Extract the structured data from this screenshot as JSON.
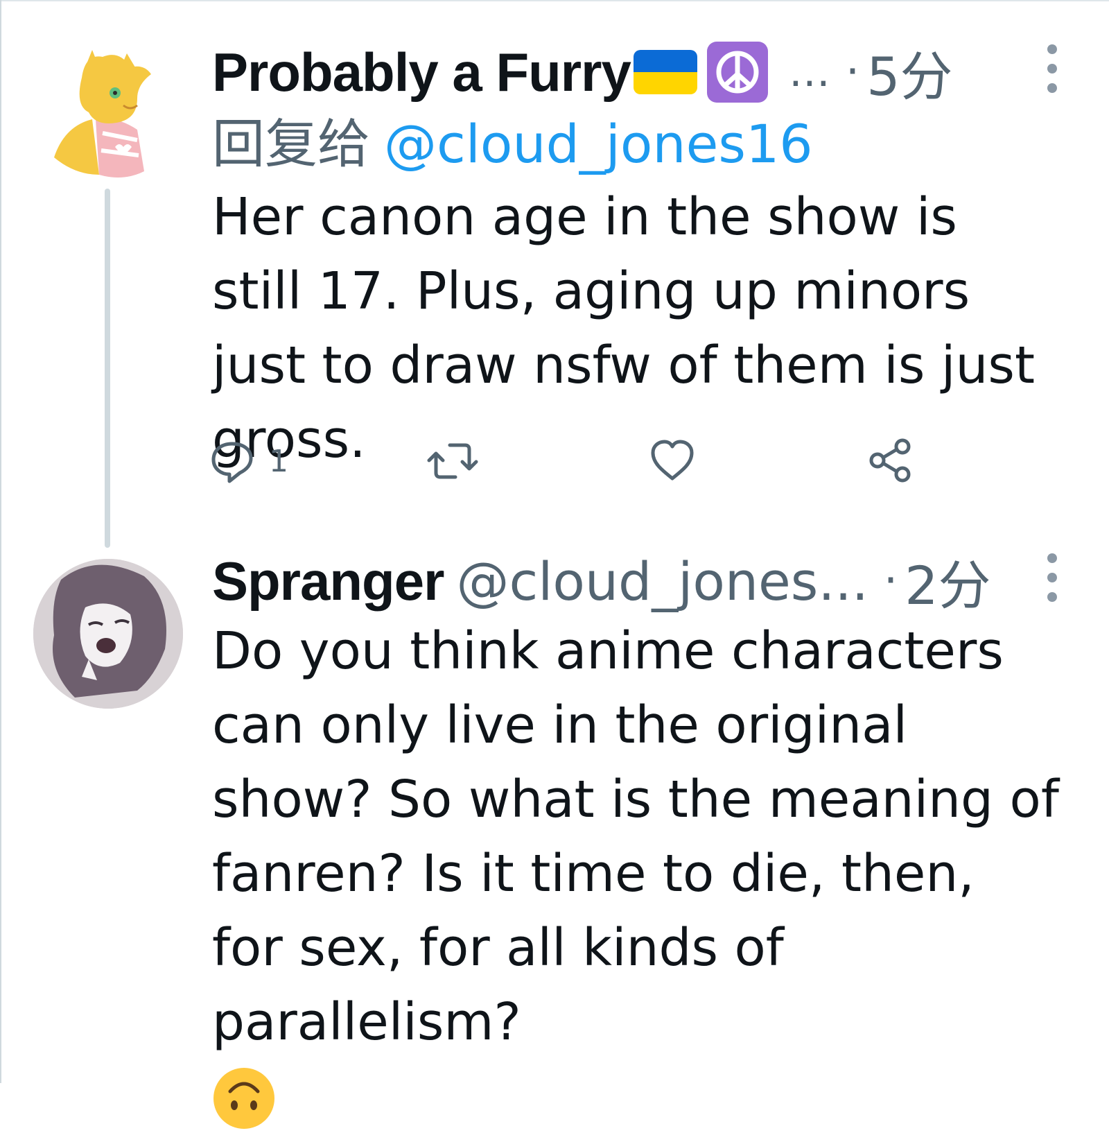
{
  "tweets": [
    {
      "display_name": "Probably a Furry",
      "name_badges": [
        "ukraine-flag",
        "peace-symbol"
      ],
      "truncation": "…",
      "separator": "·",
      "time": "5分",
      "reply_prefix": "回复给",
      "reply_mention": "@cloud_jones16",
      "text": "Her canon age in the show is still 17. Plus, aging up minors just to draw nsfw of them is just gross.",
      "actions": {
        "reply_icon": "reply-icon",
        "reply_count": "1",
        "retweet_icon": "retweet-icon",
        "like_icon": "heart-icon",
        "share_icon": "share-icon"
      }
    },
    {
      "display_name": "Spranger",
      "handle": "@cloud_jones...",
      "separator": "·",
      "time": "2分",
      "text": "Do you think anime characters can only live in the original show? So what is the meaning of fanren? Is it time to die, then, for sex, for all kinds of parallelism?",
      "trailing_emoji": "upside-down-face-emoji"
    }
  ],
  "colors": {
    "primary_text": "#0f1419",
    "secondary_text": "#536471",
    "mention": "#1d9bf0",
    "thread_line": "#cfd9de"
  }
}
